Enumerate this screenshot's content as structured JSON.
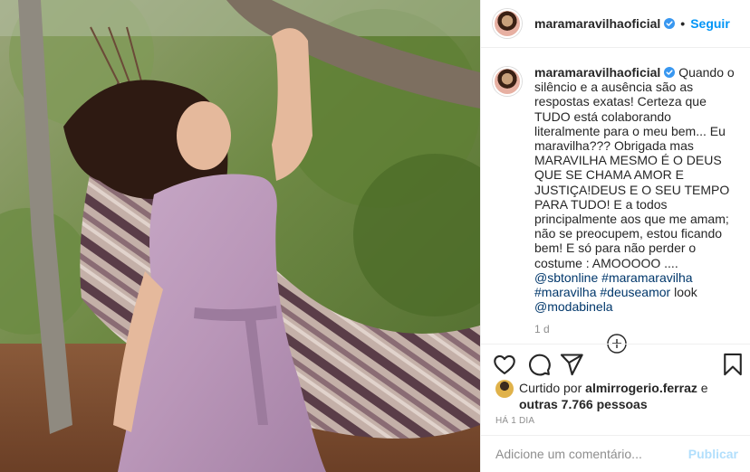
{
  "photo": {
    "alt_icon": "post-photo"
  },
  "header": {
    "username": "maramaravilhaoficial",
    "separator": "•",
    "follow_label": "Seguir"
  },
  "caption": {
    "username": "maramaravilhaoficial",
    "text_before": "Quando o silêncio e a ausência são as respostas exatas! Certeza que TUDO está colaborando literalmente para o meu bem... Eu maravilha??? Obrigada mas MARAVILHA MESMO É O DEUS QUE SE CHAMA AMOR E JUSTIÇA!DEUS E O SEU TEMPO PARA TUDO! E a todos principalmente aos que me amam; não se preocupem, estou ficando bem! E só para não perder o costume : AMOOOOO .... ",
    "mention_1": "@sbtonline",
    "hashtag_1": "#maramaravilha",
    "hashtag_2": "#maravilha",
    "hashtag_3": "#deuseamor",
    "word_look": " look ",
    "mention_2": "@modabinela",
    "age": "1 d"
  },
  "likes": {
    "prefix": "Curtido por ",
    "user": "almirrogerio.ferraz",
    "joiner": " e ",
    "count": "outras 7.766 pessoas"
  },
  "timestamp": "HÁ 1 DIA",
  "comment_box": {
    "placeholder": "Adicione um comentário...",
    "post_label": "Publicar"
  },
  "colors": {
    "accent": "#0095f6",
    "link": "#00376b",
    "muted": "#8e8e8e",
    "publish_disabled": "#b2dffc"
  },
  "icons": [
    "verified-badge-icon",
    "heart-icon",
    "comment-icon",
    "share-icon",
    "bookmark-icon",
    "load-more-icon"
  ]
}
